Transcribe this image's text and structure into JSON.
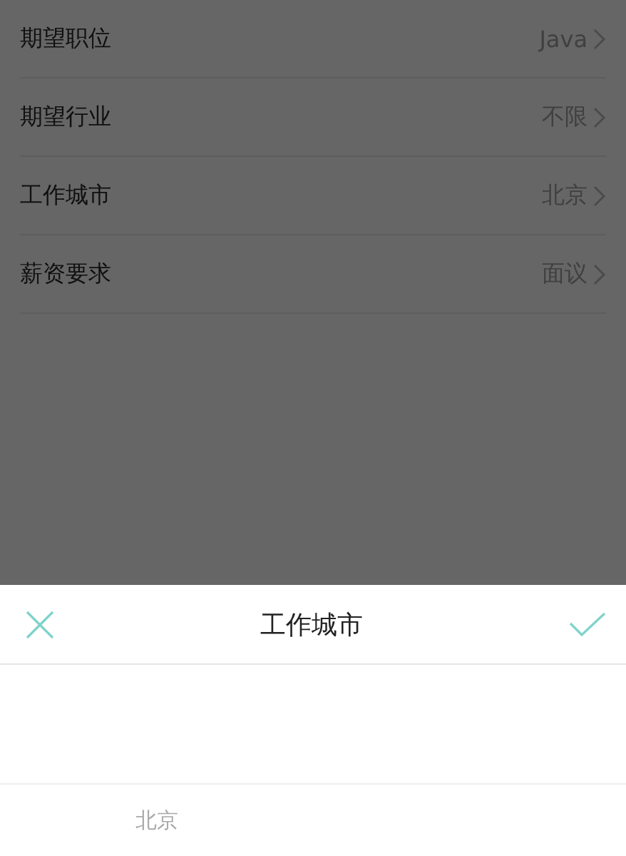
{
  "settings_list": [
    {
      "label": "期望职位",
      "value": "Java"
    },
    {
      "label": "期望行业",
      "value": "不限"
    },
    {
      "label": "工作城市",
      "value": "北京"
    },
    {
      "label": "薪资要求",
      "value": "面议"
    }
  ],
  "sheet": {
    "title": "工作城市",
    "picker_options": [
      "北京"
    ]
  }
}
